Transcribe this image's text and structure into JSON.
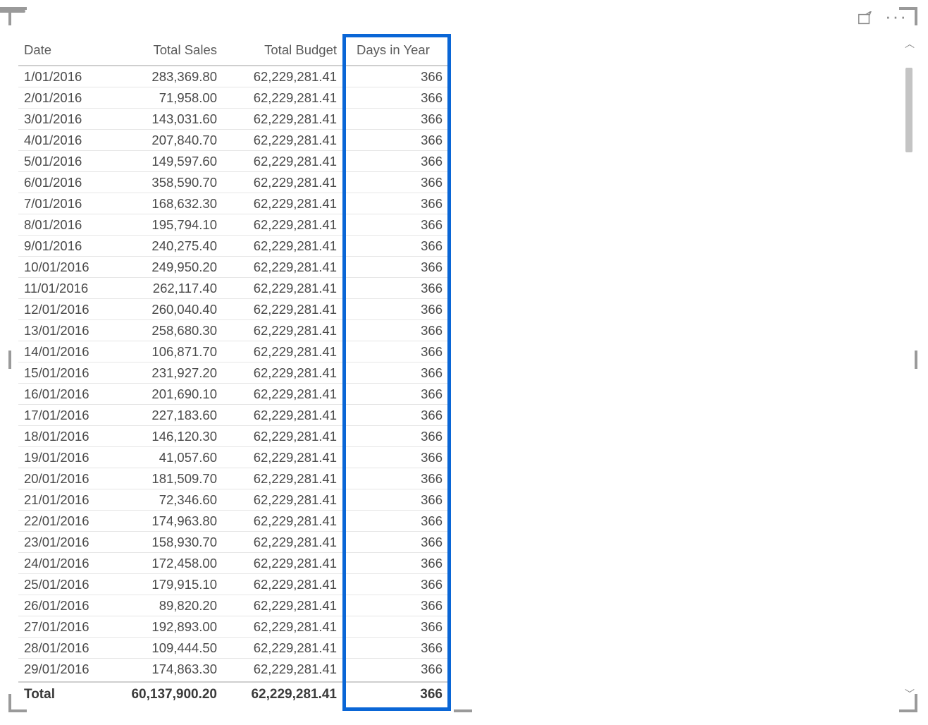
{
  "columns": {
    "date": "Date",
    "total_sales": "Total Sales",
    "total_budget": "Total Budget",
    "days_in_year": "Days in Year"
  },
  "rows": [
    {
      "date": "1/01/2016",
      "sales": "283,369.80",
      "budget": "62,229,281.41",
      "days": "366"
    },
    {
      "date": "2/01/2016",
      "sales": "71,958.00",
      "budget": "62,229,281.41",
      "days": "366"
    },
    {
      "date": "3/01/2016",
      "sales": "143,031.60",
      "budget": "62,229,281.41",
      "days": "366"
    },
    {
      "date": "4/01/2016",
      "sales": "207,840.70",
      "budget": "62,229,281.41",
      "days": "366"
    },
    {
      "date": "5/01/2016",
      "sales": "149,597.60",
      "budget": "62,229,281.41",
      "days": "366"
    },
    {
      "date": "6/01/2016",
      "sales": "358,590.70",
      "budget": "62,229,281.41",
      "days": "366"
    },
    {
      "date": "7/01/2016",
      "sales": "168,632.30",
      "budget": "62,229,281.41",
      "days": "366"
    },
    {
      "date": "8/01/2016",
      "sales": "195,794.10",
      "budget": "62,229,281.41",
      "days": "366"
    },
    {
      "date": "9/01/2016",
      "sales": "240,275.40",
      "budget": "62,229,281.41",
      "days": "366"
    },
    {
      "date": "10/01/2016",
      "sales": "249,950.20",
      "budget": "62,229,281.41",
      "days": "366"
    },
    {
      "date": "11/01/2016",
      "sales": "262,117.40",
      "budget": "62,229,281.41",
      "days": "366"
    },
    {
      "date": "12/01/2016",
      "sales": "260,040.40",
      "budget": "62,229,281.41",
      "days": "366"
    },
    {
      "date": "13/01/2016",
      "sales": "258,680.30",
      "budget": "62,229,281.41",
      "days": "366"
    },
    {
      "date": "14/01/2016",
      "sales": "106,871.70",
      "budget": "62,229,281.41",
      "days": "366"
    },
    {
      "date": "15/01/2016",
      "sales": "231,927.20",
      "budget": "62,229,281.41",
      "days": "366"
    },
    {
      "date": "16/01/2016",
      "sales": "201,690.10",
      "budget": "62,229,281.41",
      "days": "366"
    },
    {
      "date": "17/01/2016",
      "sales": "227,183.60",
      "budget": "62,229,281.41",
      "days": "366"
    },
    {
      "date": "18/01/2016",
      "sales": "146,120.30",
      "budget": "62,229,281.41",
      "days": "366"
    },
    {
      "date": "19/01/2016",
      "sales": "41,057.60",
      "budget": "62,229,281.41",
      "days": "366"
    },
    {
      "date": "20/01/2016",
      "sales": "181,509.70",
      "budget": "62,229,281.41",
      "days": "366"
    },
    {
      "date": "21/01/2016",
      "sales": "72,346.60",
      "budget": "62,229,281.41",
      "days": "366"
    },
    {
      "date": "22/01/2016",
      "sales": "174,963.80",
      "budget": "62,229,281.41",
      "days": "366"
    },
    {
      "date": "23/01/2016",
      "sales": "158,930.70",
      "budget": "62,229,281.41",
      "days": "366"
    },
    {
      "date": "24/01/2016",
      "sales": "172,458.00",
      "budget": "62,229,281.41",
      "days": "366"
    },
    {
      "date": "25/01/2016",
      "sales": "179,915.10",
      "budget": "62,229,281.41",
      "days": "366"
    },
    {
      "date": "26/01/2016",
      "sales": "89,820.20",
      "budget": "62,229,281.41",
      "days": "366"
    },
    {
      "date": "27/01/2016",
      "sales": "192,893.00",
      "budget": "62,229,281.41",
      "days": "366"
    },
    {
      "date": "28/01/2016",
      "sales": "109,444.50",
      "budget": "62,229,281.41",
      "days": "366"
    },
    {
      "date": "29/01/2016",
      "sales": "174,863.30",
      "budget": "62,229,281.41",
      "days": "366"
    }
  ],
  "total": {
    "label": "Total",
    "sales": "60,137,900.20",
    "budget": "62,229,281.41",
    "days": "366"
  },
  "highlight_column": "days_in_year",
  "colors": {
    "highlight_border": "#0a66d6"
  }
}
